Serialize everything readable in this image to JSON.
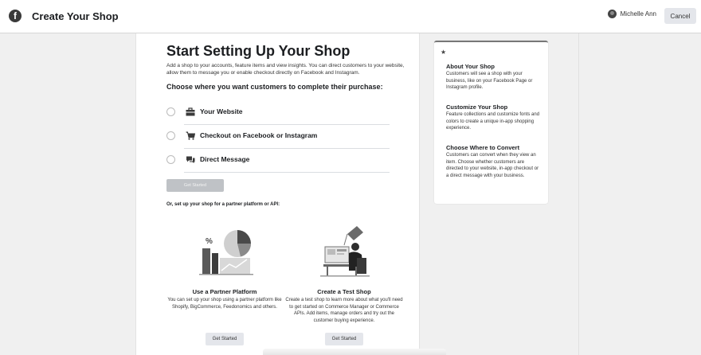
{
  "header": {
    "title": "Create Your Shop",
    "user_name": "Michelle Ann",
    "cancel_label": "Cancel",
    "logo_glyph": "f"
  },
  "main": {
    "title": "Start Setting Up Your Shop",
    "intro": "Add a shop to your accounts, feature items and view insights. You can direct customers to your website, allow them to message you or enable checkout directly on Facebook and Instagram.",
    "question": "Choose where you want customers to complete their purchase:",
    "options": [
      {
        "label": "Your Website",
        "icon": "briefcase-icon",
        "selected": false
      },
      {
        "label": "Checkout on Facebook or Instagram",
        "icon": "cart-icon",
        "selected": false
      },
      {
        "label": "Direct Message",
        "icon": "chat-icon",
        "selected": false
      }
    ],
    "get_started_label": "Get Started",
    "partner_heading": "Or, set up your shop for a partner platform or API:",
    "cards": [
      {
        "title": "Use a Partner Platform",
        "description": "You can set up your shop using a partner platform like Shopify, BigCommerce, Feedonomics and others.",
        "button": "Get Started"
      },
      {
        "title": "Create a Test Shop",
        "description": "Create a test shop to learn more about what you'll need to get started on Commerce Manager or Commerce APIs. Add items, manage orders and try out the customer buying experience.",
        "button": "Get Started"
      }
    ]
  },
  "info": {
    "icon": "star-icon",
    "sections": [
      {
        "title": "About Your Shop",
        "description": "Customers will see a shop with your business, like on your Facebook Page or Instagram profile."
      },
      {
        "title": "Customize Your Shop",
        "description": "Feature collections and customize fonts and colors to create a unique in-app shopping experience."
      },
      {
        "title": "Choose Where to Convert",
        "description": "Customers can convert when they view an item. Choose whether customers are directed to your website, in-app checkout or a direct message with your business."
      }
    ]
  }
}
